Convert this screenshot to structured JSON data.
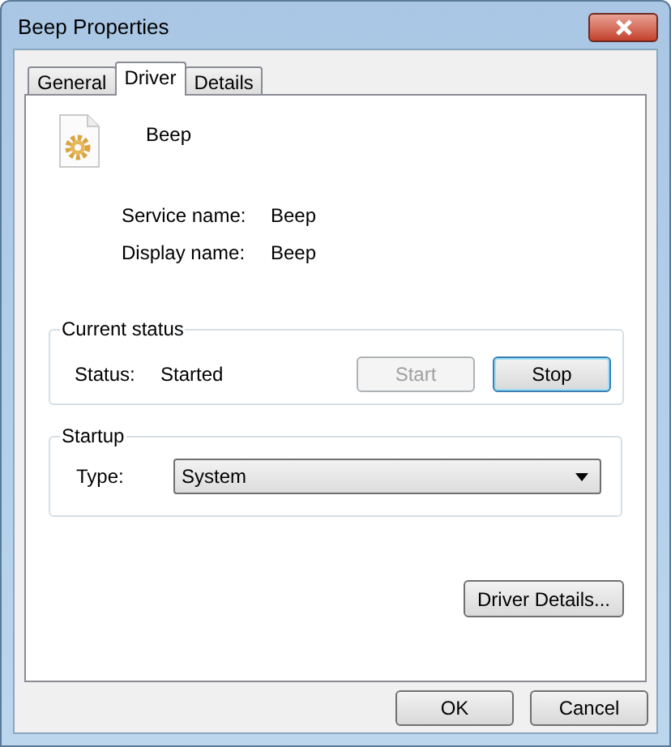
{
  "window": {
    "title": "Beep Properties"
  },
  "tabs": [
    {
      "label": "General",
      "selected": false
    },
    {
      "label": "Driver",
      "selected": true
    },
    {
      "label": "Details",
      "selected": false
    }
  ],
  "device": {
    "name": "Beep"
  },
  "fields": [
    {
      "label": "Service name:",
      "value": "Beep"
    },
    {
      "label": "Display name:",
      "value": "Beep"
    }
  ],
  "current_status": {
    "title": "Current status",
    "label": "Status:",
    "value": "Started",
    "buttons": [
      {
        "label": "Start",
        "disabled": true,
        "focused": false
      },
      {
        "label": "Stop",
        "disabled": false,
        "focused": true
      }
    ]
  },
  "startup": {
    "title": "Startup",
    "label": "Type:",
    "value": "System"
  },
  "driver_details_button": "Driver Details...",
  "buttons": [
    "OK",
    "Cancel"
  ]
}
